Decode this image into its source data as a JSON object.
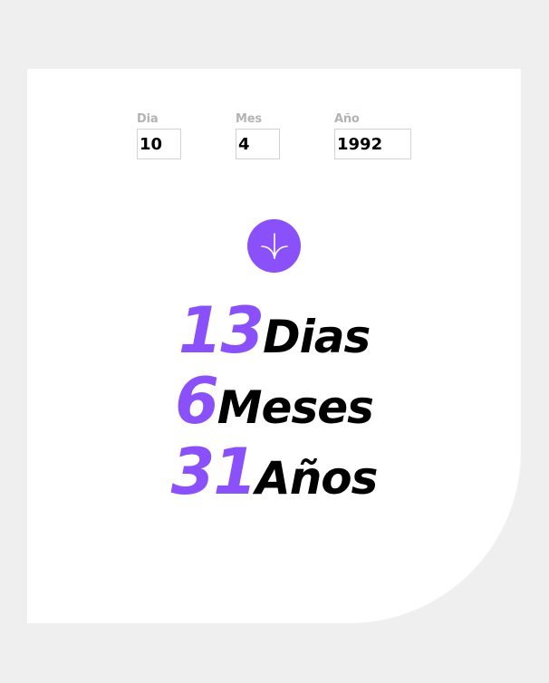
{
  "form": {
    "day": {
      "label": "Dia",
      "value": "10"
    },
    "month": {
      "label": "Mes",
      "value": "4"
    },
    "year": {
      "label": "Año",
      "value": "1992"
    }
  },
  "submit": {
    "icon": "arrow-down-icon"
  },
  "results": {
    "days": {
      "value": "13",
      "unit": "Dias"
    },
    "months": {
      "value": "6",
      "unit": "Meses"
    },
    "years": {
      "value": "31",
      "unit": "Años"
    }
  },
  "colors": {
    "accent": "#8a50fa",
    "background": "#efefef",
    "card": "#ffffff",
    "label": "#b3b3b3"
  }
}
